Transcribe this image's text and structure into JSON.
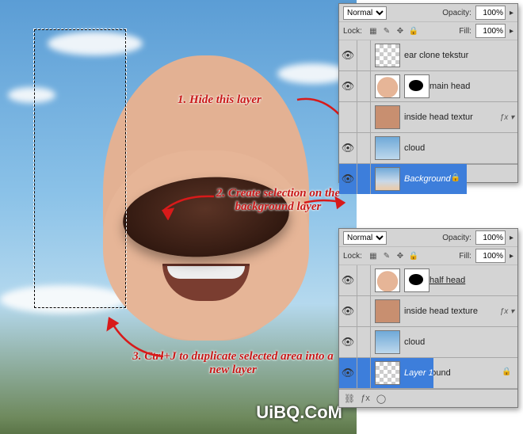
{
  "annotations": {
    "a1": "1. Hide this layer",
    "a2": "2. Create selection on the background layer",
    "a3": "3. Ctrl+J to duplicate selected area into a new layer"
  },
  "panel1": {
    "blend": "Normal",
    "opacityLabel": "Opacity:",
    "opacityVal": "100%",
    "lockLabel": "Lock:",
    "fillLabel": "Fill:",
    "fillVal": "100%",
    "layers": [
      {
        "name": "ear clone tekstur",
        "thumb": "checker"
      },
      {
        "name": "main head",
        "thumb": "head",
        "mask": true
      },
      {
        "name": "inside head textur",
        "thumb": "tex",
        "fx": true,
        "hidden": true
      },
      {
        "name": "cloud",
        "thumb": "cloud"
      },
      {
        "name": "Background",
        "thumb": "bg",
        "locked": true,
        "selected": true
      }
    ]
  },
  "panel2": {
    "blend": "Normal",
    "opacityLabel": "Opacity:",
    "opacityVal": "100%",
    "lockLabel": "Lock:",
    "fillLabel": "Fill:",
    "fillVal": "100%",
    "layers": [
      {
        "name": "half head",
        "thumb": "head",
        "mask": true,
        "underline": true
      },
      {
        "name": "inside head texture",
        "thumb": "tex",
        "fx": true
      },
      {
        "name": "cloud",
        "thumb": "cloud"
      },
      {
        "name": "Layer 1",
        "thumb": "checker",
        "selected": true
      },
      {
        "name": "Background",
        "thumb": "bg",
        "locked": true
      }
    ]
  },
  "watermark": "UiBQ.CoM"
}
